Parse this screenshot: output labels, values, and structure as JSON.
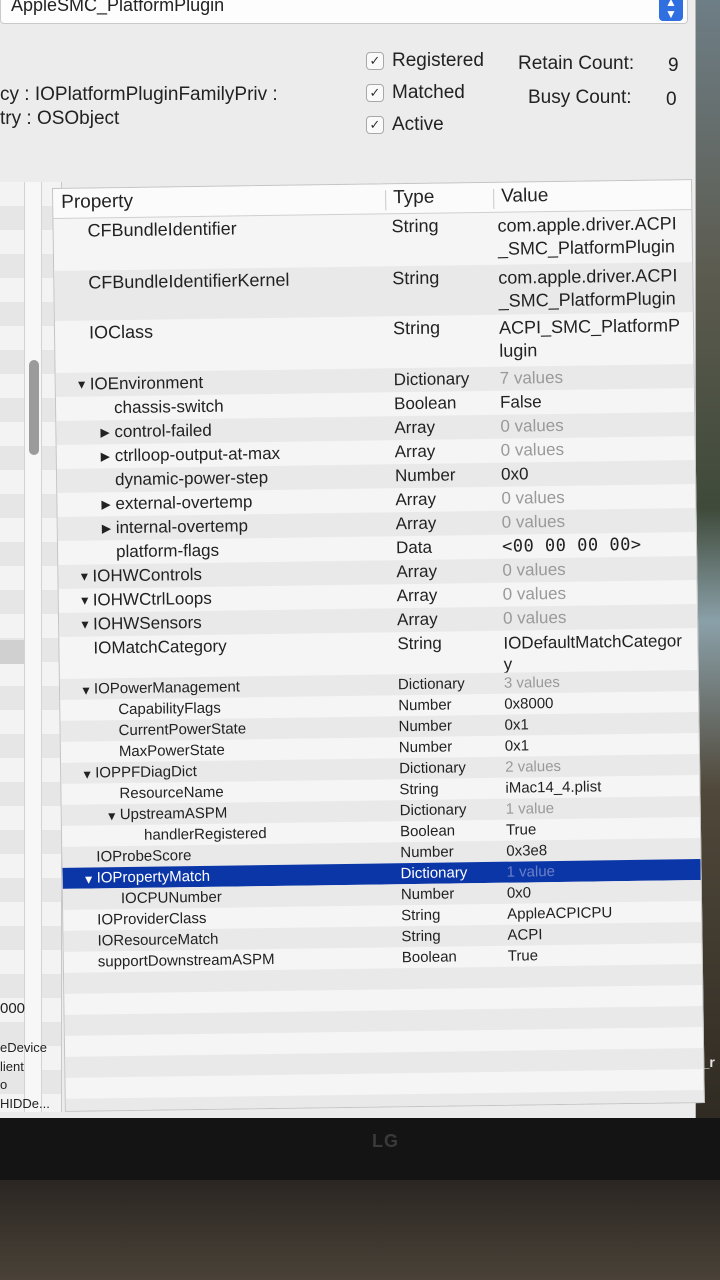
{
  "header": {
    "plane_select_value": "AppleSMC_PlatformPlugin",
    "class_hierarchy": "cy : IOPlatformPluginFamilyPriv :",
    "registry_line": "try : OSObject",
    "checkboxes": [
      {
        "label": "Registered",
        "checked": true
      },
      {
        "label": "Matched",
        "checked": true
      },
      {
        "label": "Active",
        "checked": true
      }
    ],
    "retain_count_label": "Retain Count:",
    "retain_count_value": "9",
    "busy_count_label": "Busy Count:",
    "busy_count_value": "0"
  },
  "left_panel": {
    "items": [
      "000",
      "eDevice",
      "lient",
      "o",
      "HIDDe..."
    ]
  },
  "table": {
    "columns": [
      "Property",
      "Type",
      "Value"
    ],
    "rows": [
      {
        "property": "CFBundleIdentifier",
        "type": "String",
        "value": "com.apple.driver.ACPI_SMC_PlatformPlugin",
        "indent": 0,
        "disclosure": "none"
      },
      {
        "property": "CFBundleIdentifierKernel",
        "type": "String",
        "value": "com.apple.driver.ACPI_SMC_PlatformPlugin",
        "indent": 0,
        "disclosure": "none"
      },
      {
        "property": "IOClass",
        "type": "String",
        "value": "ACPI_SMC_PlatformPlugin",
        "indent": 0,
        "disclosure": "none"
      },
      {
        "property": "IOEnvironment",
        "type": "Dictionary",
        "value": "7 values",
        "indent": 0,
        "disclosure": "open"
      },
      {
        "property": "chassis-switch",
        "type": "Boolean",
        "value": "False",
        "indent": 1,
        "disclosure": "none"
      },
      {
        "property": "control-failed",
        "type": "Array",
        "value": "0 values",
        "indent": 1,
        "disclosure": "closed"
      },
      {
        "property": "ctrlloop-output-at-max",
        "type": "Array",
        "value": "0 values",
        "indent": 1,
        "disclosure": "closed"
      },
      {
        "property": "dynamic-power-step",
        "type": "Number",
        "value": "0x0",
        "indent": 1,
        "disclosure": "none"
      },
      {
        "property": "external-overtemp",
        "type": "Array",
        "value": "0 values",
        "indent": 1,
        "disclosure": "closed"
      },
      {
        "property": "internal-overtemp",
        "type": "Array",
        "value": "0 values",
        "indent": 1,
        "disclosure": "closed"
      },
      {
        "property": "platform-flags",
        "type": "Data",
        "value": "<00 00 00 00>",
        "indent": 1,
        "disclosure": "none"
      },
      {
        "property": "IOHWControls",
        "type": "Array",
        "value": "0 values",
        "indent": 0,
        "disclosure": "open"
      },
      {
        "property": "IOHWCtrlLoops",
        "type": "Array",
        "value": "0 values",
        "indent": 0,
        "disclosure": "open"
      },
      {
        "property": "IOHWSensors",
        "type": "Array",
        "value": "0 values",
        "indent": 0,
        "disclosure": "open"
      },
      {
        "property": "IOMatchCategory",
        "type": "String",
        "value": "IODefaultMatchCategory",
        "indent": 0,
        "disclosure": "none"
      },
      {
        "property": "IOPowerManagement",
        "type": "Dictionary",
        "value": "3 values",
        "indent": 0,
        "disclosure": "open"
      },
      {
        "property": "CapabilityFlags",
        "type": "Number",
        "value": "0x8000",
        "indent": 1,
        "disclosure": "none"
      },
      {
        "property": "CurrentPowerState",
        "type": "Number",
        "value": "0x1",
        "indent": 1,
        "disclosure": "none"
      },
      {
        "property": "MaxPowerState",
        "type": "Number",
        "value": "0x1",
        "indent": 1,
        "disclosure": "none"
      },
      {
        "property": "IOPPFDiagDict",
        "type": "Dictionary",
        "value": "2 values",
        "indent": 0,
        "disclosure": "open"
      },
      {
        "property": "ResourceName",
        "type": "String",
        "value": "iMac14_4.plist",
        "indent": 1,
        "disclosure": "none"
      },
      {
        "property": "UpstreamASPM",
        "type": "Dictionary",
        "value": "1 value",
        "indent": 1,
        "disclosure": "open"
      },
      {
        "property": "handlerRegistered",
        "type": "Boolean",
        "value": "True",
        "indent": 2,
        "disclosure": "none"
      },
      {
        "property": "IOProbeScore",
        "type": "Number",
        "value": "0x3e8",
        "indent": 0,
        "disclosure": "none"
      },
      {
        "property": "IOPropertyMatch",
        "type": "Dictionary",
        "value": "1 value",
        "indent": 0,
        "disclosure": "open",
        "selected": true
      },
      {
        "property": "IOCPUNumber",
        "type": "Number",
        "value": "0x0",
        "indent": 1,
        "disclosure": "none"
      },
      {
        "property": "IOProviderClass",
        "type": "String",
        "value": "AppleACPICPU",
        "indent": 0,
        "disclosure": "none"
      },
      {
        "property": "IOResourceMatch",
        "type": "String",
        "value": "ACPI",
        "indent": 0,
        "disclosure": "none"
      },
      {
        "property": "supportDownstreamASPM",
        "type": "Boolean",
        "value": "True",
        "indent": 0,
        "disclosure": "none"
      }
    ]
  },
  "desktop": {
    "icon_label": "Clover_r"
  },
  "monitor": {
    "brand": "LG"
  },
  "colors": {
    "selection": "#0b36a8",
    "window_bg": "#ececec",
    "accent": "#2f6fe0"
  }
}
